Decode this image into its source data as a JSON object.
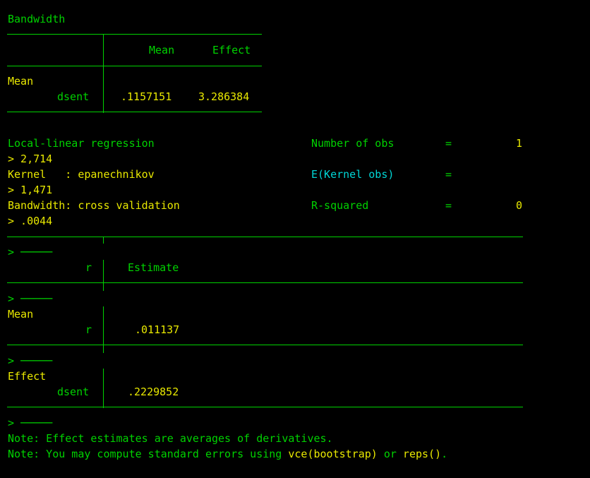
{
  "bandwidth_table": {
    "title": "Bandwidth",
    "col_mean": "Mean",
    "col_effect": "Effect",
    "row_group": "Mean",
    "row_label": "dsent",
    "mean_value": ".1157151",
    "effect_value": "3.286384"
  },
  "summary": {
    "left": [
      "Local-linear regression",
      "> 2,714",
      "Kernel   : epanechnikov",
      "> 1,471",
      "Bandwidth: cross validation",
      "> .0044"
    ],
    "obs_label": "Number of obs",
    "obs_eq": "=",
    "obs_value": "1",
    "kernel_obs_label": "E(Kernel obs)",
    "kernel_obs_eq": "=",
    "rsq_label": "R-squared",
    "rsq_eq": "=",
    "rsq_value": "0"
  },
  "results_table": {
    "wrap_marker": "> ─────",
    "header_var": "r",
    "header_col": "Estimate",
    "group_mean": "Mean",
    "mean_row_label": "r",
    "mean_row_value": ".011137",
    "group_effect": "Effect",
    "effect_row_label": "dsent",
    "effect_row_value": ".2229852"
  },
  "notes": {
    "note1": "Note: Effect estimates are averages of derivatives.",
    "note2_prefix": "Note: You may compute standard errors using ",
    "note2_cmd1": "vce(bootstrap)",
    "note2_or": " or ",
    "note2_cmd2": "reps()",
    "note2_suffix": "."
  }
}
